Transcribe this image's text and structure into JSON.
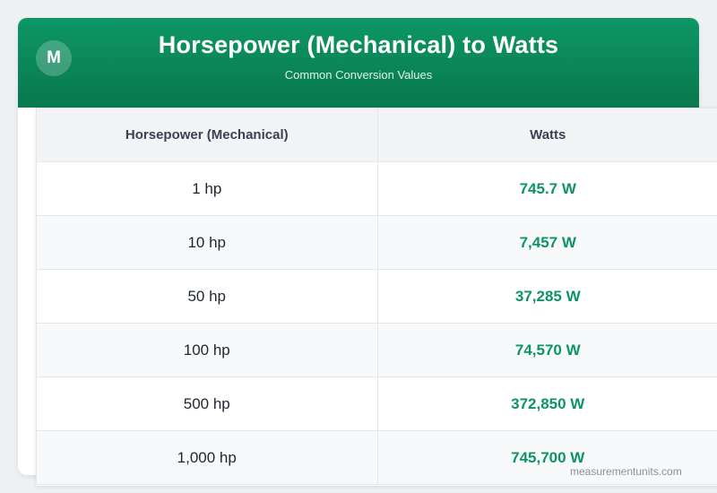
{
  "header": {
    "logo_letter": "M",
    "title": "Horsepower (Mechanical) to Watts",
    "subtitle": "Common Conversion Values"
  },
  "table": {
    "columns": [
      "Horsepower (Mechanical)",
      "Watts"
    ],
    "rows": [
      {
        "hp": "1 hp",
        "watts": "745.7 W"
      },
      {
        "hp": "10 hp",
        "watts": "7,457 W"
      },
      {
        "hp": "50 hp",
        "watts": "37,285 W"
      },
      {
        "hp": "100 hp",
        "watts": "74,570 W"
      },
      {
        "hp": "500 hp",
        "watts": "372,850 W"
      },
      {
        "hp": "1,000 hp",
        "watts": "745,700 W"
      }
    ]
  },
  "footer": {
    "site": "measurementunits.com"
  },
  "colors": {
    "brand_green": "#0e9766",
    "value_green": "#0e9464"
  }
}
